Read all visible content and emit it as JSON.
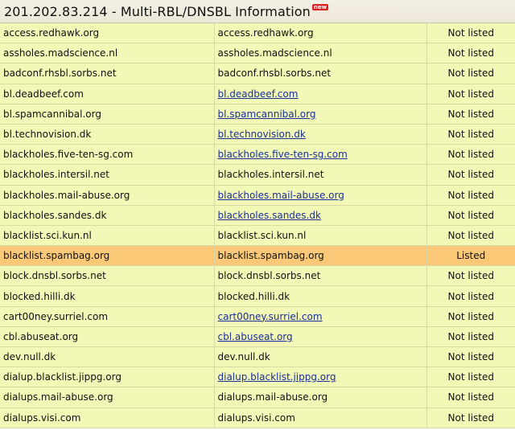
{
  "header": {
    "title": "201.202.83.214 - Multi-RBL/DNSBL Information",
    "badge": "new"
  },
  "rows": [
    {
      "server": "access.redhawk.org",
      "lookup": "access.redhawk.org",
      "linked": false,
      "status": "Not listed",
      "listed": false
    },
    {
      "server": "assholes.madscience.nl",
      "lookup": "assholes.madscience.nl",
      "linked": false,
      "status": "Not listed",
      "listed": false
    },
    {
      "server": "badconf.rhsbl.sorbs.net",
      "lookup": "badconf.rhsbl.sorbs.net",
      "linked": false,
      "status": "Not listed",
      "listed": false
    },
    {
      "server": "bl.deadbeef.com",
      "lookup": "bl.deadbeef.com",
      "linked": true,
      "status": "Not listed",
      "listed": false
    },
    {
      "server": "bl.spamcannibal.org",
      "lookup": "bl.spamcannibal.org",
      "linked": true,
      "status": "Not listed",
      "listed": false
    },
    {
      "server": "bl.technovision.dk",
      "lookup": "bl.technovision.dk",
      "linked": true,
      "status": "Not listed",
      "listed": false
    },
    {
      "server": "blackholes.five-ten-sg.com",
      "lookup": "blackholes.five-ten-sg.com",
      "linked": true,
      "status": "Not listed",
      "listed": false
    },
    {
      "server": "blackholes.intersil.net",
      "lookup": "blackholes.intersil.net",
      "linked": false,
      "status": "Not listed",
      "listed": false
    },
    {
      "server": "blackholes.mail-abuse.org",
      "lookup": "blackholes.mail-abuse.org",
      "linked": true,
      "status": "Not listed",
      "listed": false
    },
    {
      "server": "blackholes.sandes.dk",
      "lookup": "blackholes.sandes.dk",
      "linked": true,
      "status": "Not listed",
      "listed": false
    },
    {
      "server": "blacklist.sci.kun.nl",
      "lookup": "blacklist.sci.kun.nl",
      "linked": false,
      "status": "Not listed",
      "listed": false
    },
    {
      "server": "blacklist.spambag.org",
      "lookup": "blacklist.spambag.org",
      "linked": false,
      "status": "Listed",
      "listed": true
    },
    {
      "server": "block.dnsbl.sorbs.net",
      "lookup": "block.dnsbl.sorbs.net",
      "linked": false,
      "status": "Not listed",
      "listed": false
    },
    {
      "server": "blocked.hilli.dk",
      "lookup": "blocked.hilli.dk",
      "linked": false,
      "status": "Not listed",
      "listed": false
    },
    {
      "server": "cart00ney.surriel.com",
      "lookup": "cart00ney.surriel.com",
      "linked": true,
      "status": "Not listed",
      "listed": false
    },
    {
      "server": "cbl.abuseat.org",
      "lookup": "cbl.abuseat.org",
      "linked": true,
      "status": "Not listed",
      "listed": false
    },
    {
      "server": "dev.null.dk",
      "lookup": "dev.null.dk",
      "linked": false,
      "status": "Not listed",
      "listed": false
    },
    {
      "server": "dialup.blacklist.jippg.org",
      "lookup": "dialup.blacklist.jippg.org",
      "linked": true,
      "status": "Not listed",
      "listed": false
    },
    {
      "server": "dialups.mail-abuse.org",
      "lookup": "dialups.mail-abuse.org",
      "linked": false,
      "status": "Not listed",
      "listed": false
    },
    {
      "server": "dialups.visi.com",
      "lookup": "dialups.visi.com",
      "linked": false,
      "status": "Not listed",
      "listed": false
    }
  ],
  "colors": {
    "row_bg": "#f2f8b6",
    "listed_bg": "#fbc877",
    "link": "#1b2f9c",
    "border": "#dad9a6"
  }
}
